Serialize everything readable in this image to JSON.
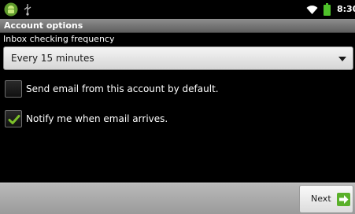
{
  "status_bar": {
    "time": "8:30",
    "icons": [
      "android-icon",
      "usb-icon",
      "wifi-icon",
      "battery-icon"
    ]
  },
  "title_bar": {
    "title": "Account options"
  },
  "frequency": {
    "label": "Inbox checking frequency",
    "selected": "Every 15 minutes"
  },
  "options": [
    {
      "label": "Send email from this account by default.",
      "checked": false
    },
    {
      "label": "Notify me when email arrives.",
      "checked": true
    }
  ],
  "footer": {
    "next_label": "Next",
    "next_icon": "arrow-right-icon"
  },
  "colors": {
    "check_green": "#7cc02a",
    "next_icon_green": "#5ab02a"
  }
}
